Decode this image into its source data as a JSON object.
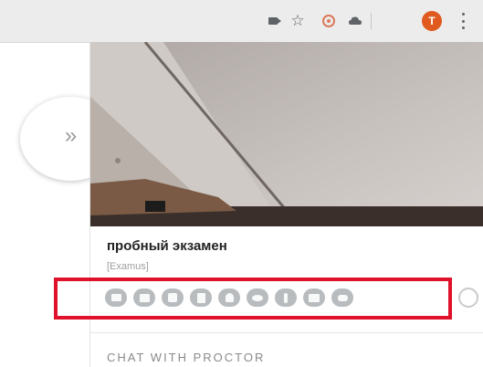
{
  "browser": {
    "toolbar_icons": [
      "camera-icon",
      "star-icon",
      "extension-icon",
      "cloud-icon"
    ],
    "profile_initial": "T",
    "accent_color": "#e05a1f"
  },
  "sidebar": {
    "collapse_label": "»"
  },
  "exam": {
    "title": "пробный экзамен",
    "subtitle": "[Examus]"
  },
  "tools": {
    "icons": [
      "screen-share-icon",
      "image-icon",
      "film-icon",
      "calculator-icon",
      "user-icon",
      "eye-icon",
      "info-icon",
      "book-icon",
      "chat-icon"
    ],
    "highlight_color": "#e0112a"
  },
  "chat": {
    "header": "CHAT WITH PROCTOR"
  }
}
